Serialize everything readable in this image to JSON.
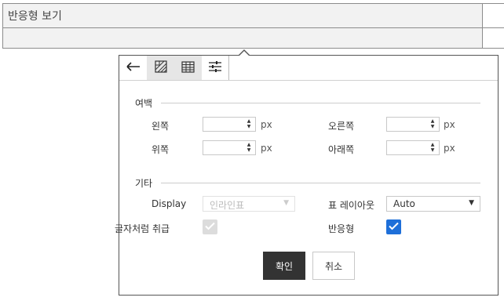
{
  "table": {
    "row1_text": "반응형 보기",
    "row2_text": ""
  },
  "toolbar": {
    "buttons": [
      {
        "icon": "back-arrow-icon",
        "active": false
      },
      {
        "icon": "cell-background-icon",
        "active": false
      },
      {
        "icon": "table-grid-icon",
        "active": false
      },
      {
        "icon": "sliders-icon",
        "active": true
      }
    ]
  },
  "margin_section": {
    "title": "여백",
    "left_label": "왼쪽",
    "right_label": "오른쪽",
    "top_label": "위쪽",
    "bottom_label": "아래쪽",
    "left_value": "",
    "right_value": "",
    "top_value": "",
    "bottom_value": "",
    "unit": "px"
  },
  "etc_section": {
    "title": "기타",
    "display_label": "Display",
    "display_value": "인라인표",
    "table_layout_label": "표 레이아웃",
    "table_layout_value": "Auto",
    "treat_as_char_label": "글자처럼 취급",
    "treat_as_char_checked": true,
    "treat_as_char_disabled": true,
    "responsive_label": "반응형",
    "responsive_checked": true
  },
  "actions": {
    "confirm_label": "확인",
    "cancel_label": "취소"
  },
  "colors": {
    "accent": "#1e6fd9",
    "primary_button": "#333333"
  }
}
